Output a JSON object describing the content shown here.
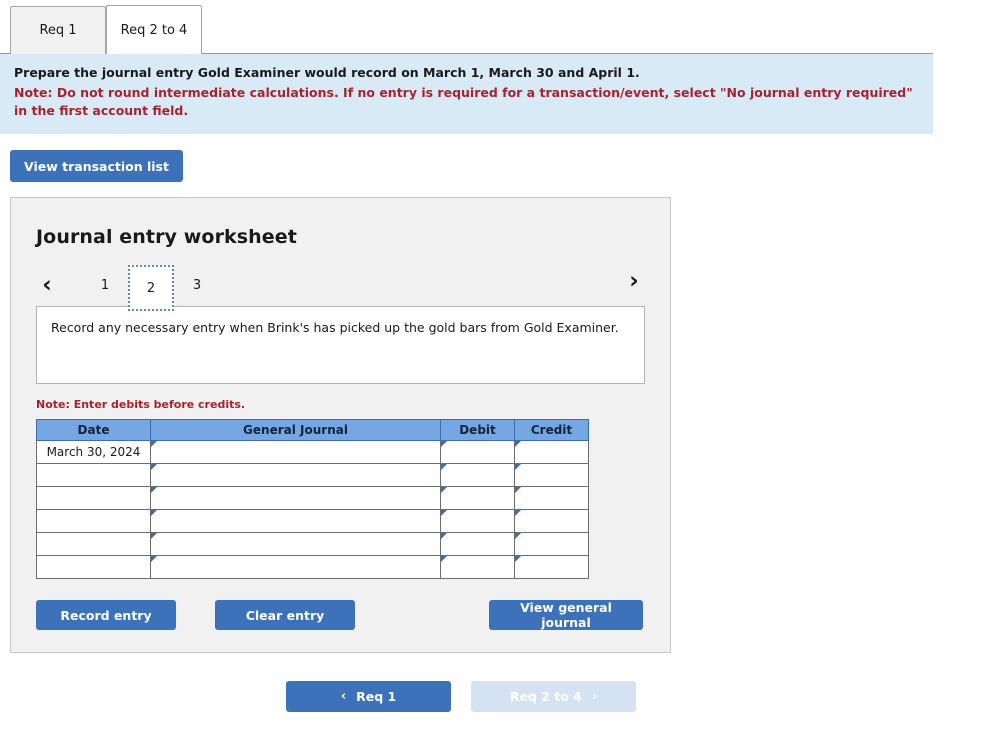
{
  "tabs": [
    {
      "label": "Req 1",
      "active": false
    },
    {
      "label": "Req 2 to 4",
      "active": true
    }
  ],
  "banner": {
    "line1": "Prepare the journal entry Gold Examiner would record on March 1, March 30 and April 1.",
    "note": "Note: Do not round intermediate calculations. If no entry is required for a transaction/event, select \"No journal entry required\" in the first account field."
  },
  "toolbar": {
    "view_transaction_list": "View transaction list"
  },
  "worksheet": {
    "title": "Journal entry worksheet",
    "pager": {
      "prev_icon": "‹",
      "next_icon": "›",
      "pages": [
        "1",
        "2",
        "3"
      ],
      "selected": "2"
    },
    "description": "Record any necessary entry when Brink's has picked up the gold bars from Gold Examiner.",
    "note": "Note: Enter debits before credits.",
    "table": {
      "columns": [
        "Date",
        "General Journal",
        "Debit",
        "Credit"
      ],
      "rows": [
        {
          "date": "March 30, 2024",
          "general_journal": "",
          "debit": "",
          "credit": ""
        },
        {
          "date": "",
          "general_journal": "",
          "debit": "",
          "credit": ""
        },
        {
          "date": "",
          "general_journal": "",
          "debit": "",
          "credit": ""
        },
        {
          "date": "",
          "general_journal": "",
          "debit": "",
          "credit": ""
        },
        {
          "date": "",
          "general_journal": "",
          "debit": "",
          "credit": ""
        },
        {
          "date": "",
          "general_journal": "",
          "debit": "",
          "credit": ""
        }
      ]
    },
    "actions": {
      "record_entry": "Record entry",
      "clear_entry": "Clear entry",
      "view_general_journal": "View general journal"
    }
  },
  "bottom_nav": {
    "prev_label": "Req 1",
    "prev_icon": "‹",
    "next_label": "Req 2 to 4",
    "next_icon": "›",
    "next_disabled": true
  },
  "colors": {
    "accent_blue": "#3b72b9",
    "table_header_blue": "#74a7e3",
    "banner_blue": "#d9eaf7",
    "note_red": "#a6232e",
    "disabled_blue": "#d4e2f2"
  }
}
